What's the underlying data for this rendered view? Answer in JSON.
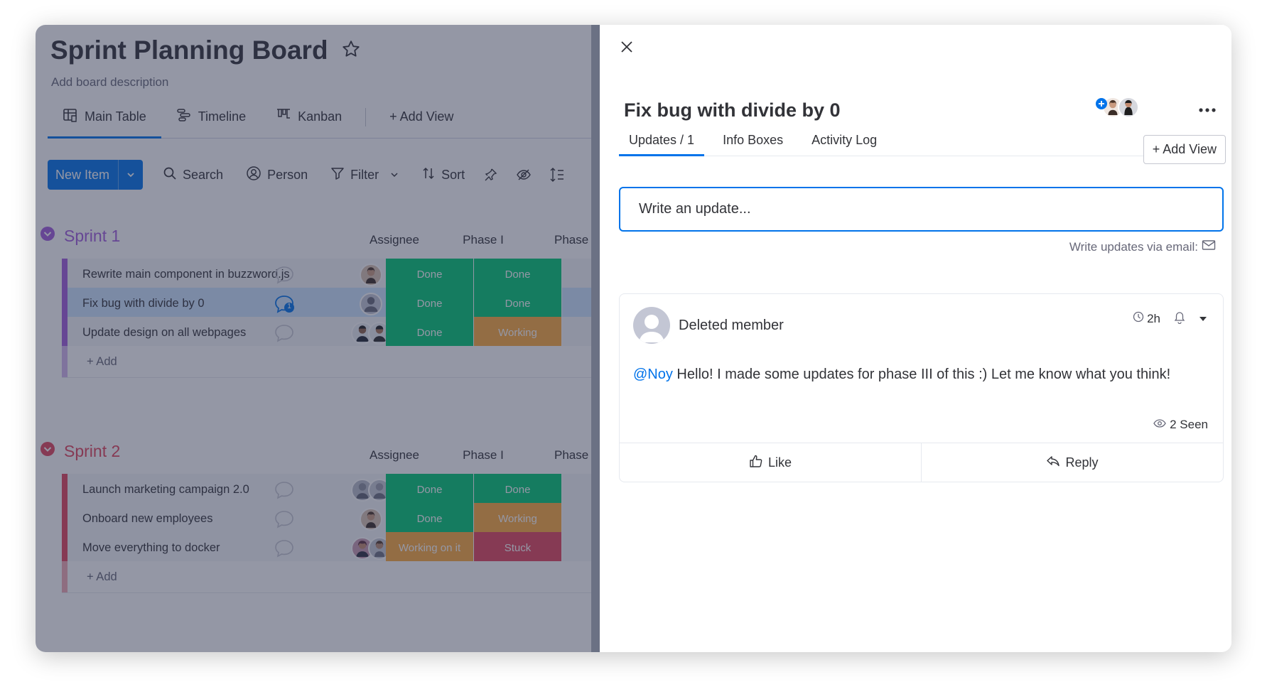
{
  "board": {
    "title": "Sprint Planning Board",
    "description": "Add board description",
    "views": [
      {
        "label": "Main Table",
        "icon": "table-icon"
      },
      {
        "label": "Timeline",
        "icon": "timeline-icon"
      },
      {
        "label": "Kanban",
        "icon": "kanban-icon"
      }
    ],
    "add_view": "+ Add View",
    "toolbar": {
      "new_item": "New Item",
      "search": "Search",
      "person": "Person",
      "filter": "Filter",
      "sort": "Sort"
    },
    "column_headers": {
      "assignee": "Assignee",
      "phase1": "Phase I",
      "phase2": "Phase"
    },
    "groups": [
      {
        "name": "Sprint 1",
        "color": "#a25ddc",
        "add_label": "+ Add",
        "rows": [
          {
            "name": "Rewrite main component in buzzword.js",
            "updates": "",
            "phase1": "Done",
            "phase2": "Done"
          },
          {
            "name": "Fix bug with divide by 0",
            "updates": "1",
            "phase1": "Done",
            "phase2": "Done"
          },
          {
            "name": "Update design on all webpages",
            "updates": "",
            "phase1": "Done",
            "phase2": "Working"
          }
        ]
      },
      {
        "name": "Sprint 2",
        "color": "#e2445c",
        "add_label": "+ Add",
        "rows": [
          {
            "name": "Launch marketing campaign 2.0",
            "updates": "",
            "phase1": "Done",
            "phase2": "Done"
          },
          {
            "name": "Onboard new employees",
            "updates": "",
            "phase1": "Done",
            "phase2": "Working"
          },
          {
            "name": "Move everything to docker",
            "updates": "",
            "phase1": "Working on it",
            "phase2": "Stuck"
          }
        ]
      }
    ],
    "status_colors": {
      "Done": "#00c875",
      "Working": "#fdab3d",
      "Working on it": "#fdab3d",
      "Stuck": "#e2445c"
    }
  },
  "panel": {
    "item_title": "Fix bug with divide by 0",
    "tabs": [
      "Updates / 1",
      "Info Boxes",
      "Activity Log"
    ],
    "add_view": "+ Add View",
    "input_placeholder": "Write an update...",
    "email_hint": "Write updates via email:",
    "post": {
      "author": "Deleted member",
      "time": "2h",
      "mention": "@Noy",
      "text": " Hello! I made some updates for phase III of this :) Let me know what you think!",
      "seen": "2 Seen",
      "like": "Like",
      "reply": "Reply"
    }
  },
  "accent": "#0073ea"
}
